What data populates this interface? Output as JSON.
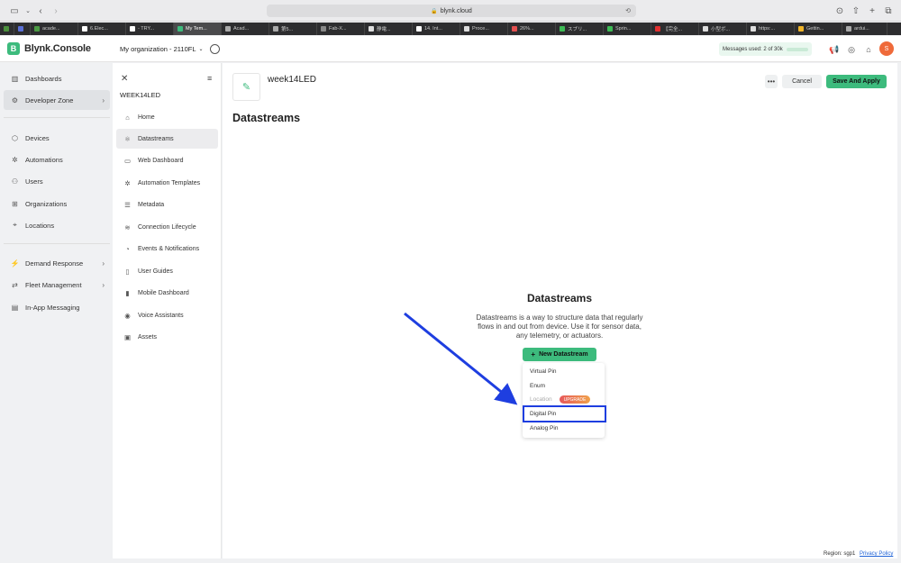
{
  "browser": {
    "url": "blynk.cloud",
    "tabs": [
      {
        "label": "",
        "color": "#4b8f3c"
      },
      {
        "label": "",
        "color": "#5a6fd6"
      },
      {
        "label": "acade...",
        "color": "#4b9a43"
      },
      {
        "label": "6.Elec...",
        "color": "#ffffff"
      },
      {
        "label": "- TRY...",
        "color": "#ffffff"
      },
      {
        "label": "My Tem...",
        "color": "#3dbb7d"
      },
      {
        "label": "Acad...",
        "color": "#aaaaaa"
      },
      {
        "label": "第5...",
        "color": "#aaaaaa"
      },
      {
        "label": "Fab-X...",
        "color": "#888888"
      },
      {
        "label": "静電...",
        "color": "#dddddd"
      },
      {
        "label": "14. Int...",
        "color": "#ffffff"
      },
      {
        "label": "Proce...",
        "color": "#dddddd"
      },
      {
        "label": "26%...",
        "color": "#e35050"
      },
      {
        "label": "スプリ...",
        "color": "#3dbb55"
      },
      {
        "label": "Sprin...",
        "color": "#3dbb55"
      },
      {
        "label": "【完全...",
        "color": "#e23030"
      },
      {
        "label": "小型ボ...",
        "color": "#dddddd"
      },
      {
        "label": "https:...",
        "color": "#dddddd"
      },
      {
        "label": "Gettin...",
        "color": "#f0b428"
      },
      {
        "label": "ardui...",
        "color": "#aaaaaa"
      }
    ]
  },
  "header": {
    "logo_letter": "B",
    "app_name": "Blynk.Console",
    "org_name": "My organization - 2110FL",
    "messages_used": "Messages used: 2 of 30k",
    "avatar_initial": "S"
  },
  "leftnav": {
    "items": [
      {
        "label": "Dashboards"
      },
      {
        "label": "Developer Zone"
      },
      {
        "label": "Devices"
      },
      {
        "label": "Automations"
      },
      {
        "label": "Users"
      },
      {
        "label": "Organizations"
      },
      {
        "label": "Locations"
      },
      {
        "label": "Demand Response"
      },
      {
        "label": "Fleet Management"
      },
      {
        "label": "In-App Messaging"
      }
    ]
  },
  "template_nav": {
    "name": "WEEK14LED",
    "items": [
      {
        "label": "Home"
      },
      {
        "label": "Datastreams"
      },
      {
        "label": "Web Dashboard"
      },
      {
        "label": "Automation Templates"
      },
      {
        "label": "Metadata"
      },
      {
        "label": "Connection Lifecycle"
      },
      {
        "label": "Events & Notifications"
      },
      {
        "label": "User Guides"
      },
      {
        "label": "Mobile Dashboard"
      },
      {
        "label": "Voice Assistants"
      },
      {
        "label": "Assets"
      }
    ]
  },
  "main": {
    "template_title": "week14LED",
    "more_label": "•••",
    "cancel_label": "Cancel",
    "save_label": "Save And Apply",
    "page_heading": "Datastreams",
    "empty_title": "Datastreams",
    "empty_desc": "Datastreams is a way to structure data that regularly flows in and out from device. Use it for sensor data, any telemetry, or actuators.",
    "new_button_label": "New Datastream",
    "menu": {
      "options": [
        {
          "label": "Virtual Pin"
        },
        {
          "label": "Enum"
        },
        {
          "label": "Location"
        },
        {
          "label": "Digital Pin"
        },
        {
          "label": "Analog Pin"
        }
      ],
      "upgrade_label": "UPGRADE"
    }
  },
  "footer": {
    "region": "Region: sgp1",
    "privacy": "Privacy Policy"
  },
  "colors": {
    "brand_green": "#3dbb7d",
    "annotation_blue": "#1e3ee0"
  }
}
